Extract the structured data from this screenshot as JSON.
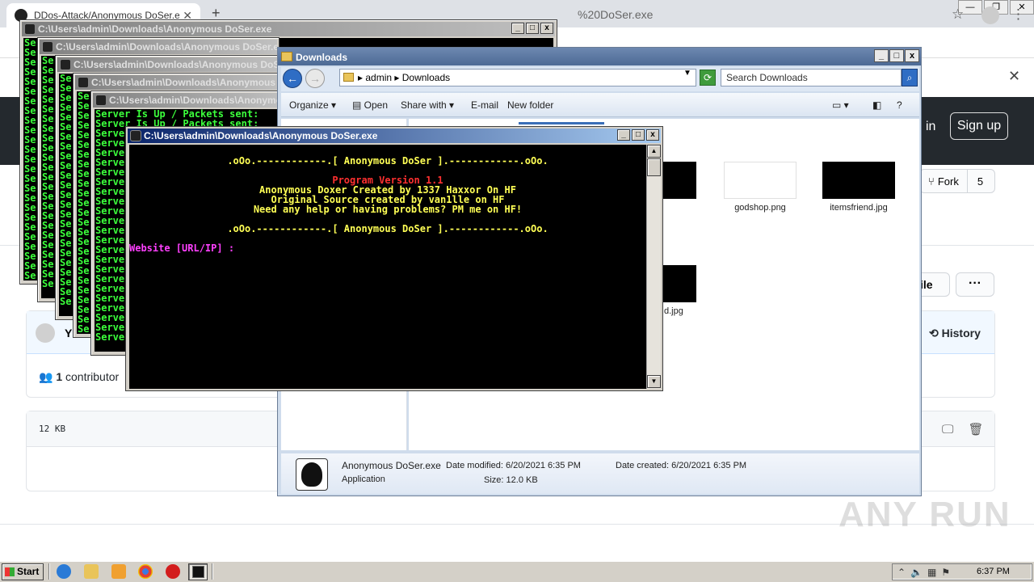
{
  "browser": {
    "tab_title": "DDos-Attack/Anonymous DoSer.exe",
    "tab_close": "✕",
    "new_tab": "+",
    "url_fragment": "%20DoSer.exe",
    "window_buttons": [
      "—",
      "❐",
      "✕"
    ]
  },
  "github": {
    "sign_in": "in",
    "sign_up": "Sign up",
    "fork_label": "Fork",
    "fork_count": "5",
    "file_button": "ile",
    "more_button": "···",
    "author_initial": "Y",
    "history": "History",
    "contributors_count": "1",
    "contributors_label": "contributor",
    "file_size": "12 KB"
  },
  "bg_consoles": [
    {
      "title": "C:\\Users\\admin\\Downloads\\Anonymous DoSer.exe",
      "lines": [
        "Se",
        "Se",
        "Se",
        "Se",
        "Se",
        "Se",
        "Se",
        "Se",
        "Se",
        "Se",
        "Se",
        "Se",
        "Se",
        "Se",
        "Se",
        "Se",
        "Se",
        "Se",
        "Se",
        "Se",
        "Se",
        "Se",
        "Se",
        "Se",
        "Se"
      ]
    },
    {
      "title": "C:\\Users\\admin\\Downloads\\Anonymous DoSer.exe",
      "lines": [
        "Se",
        "Se",
        "Se",
        "Se",
        "Se",
        "Se",
        "Se",
        "Se",
        "Se",
        "Se",
        "Se",
        "Se",
        "Se",
        "Se",
        "Se",
        "Se",
        "Se",
        "Se",
        "Se",
        "Se",
        "Se",
        "Se",
        "Se",
        "Se"
      ]
    },
    {
      "title": "C:\\Users\\admin\\Downloads\\Anonymous DoSer.exe",
      "lines": [
        "Se",
        "Se",
        "Se",
        "Se",
        "Se",
        "Se",
        "Se",
        "Se",
        "Se",
        "Se",
        "Se",
        "Se",
        "Se",
        "Se",
        "Se",
        "Se",
        "Se",
        "Se",
        "Se",
        "Se",
        "Se",
        "Se",
        "Se",
        "Se"
      ]
    },
    {
      "title": "C:\\Users\\admin\\Downloads\\Anonymous DoSer.exe",
      "lines": [
        "Se",
        "Se",
        "Se",
        "Se",
        "Se",
        "Se",
        "Se",
        "Se",
        "Se",
        "Se",
        "Se",
        "Se",
        "Se",
        "Se",
        "Se",
        "Se",
        "Se",
        "Se",
        "Se",
        "Se",
        "Se",
        "Se",
        "Se",
        "Se",
        "Se"
      ]
    },
    {
      "title": "C:\\Users\\admin\\Downloads\\Anonymous DoSer.exe",
      "lines": [
        "Server Is Up / Packets sent:",
        "Server Is Up / Packets sent:",
        "Serve",
        "Serve",
        "Serve",
        "Serve",
        "Serve",
        "Serve",
        "Serve",
        "Serve",
        "Serve",
        "Serve",
        "Serve",
        "Serve",
        "Serve",
        "Serve",
        "Serve",
        "Serve",
        "Serve",
        "Serve",
        "Serve",
        "Serve",
        "Serve",
        "Serve"
      ]
    }
  ],
  "explorer": {
    "title": "Downloads",
    "path": [
      "admin",
      "Downloads"
    ],
    "search_placeholder": "Search Downloads",
    "toolbar": {
      "organize": "Organize",
      "open": "Open",
      "share_with": "Share with",
      "email": "E-mail",
      "new_folder": "New folder"
    },
    "files": [
      {
        "name": "d.jpg"
      },
      {
        "name": "godshop.png"
      },
      {
        "name": "itemsfriend.jpg"
      },
      {
        "name": "d.jpg"
      }
    ],
    "details": {
      "file_name": "Anonymous DoSer.exe",
      "type": "Application",
      "date_modified_label": "Date modified:",
      "date_modified": "6/20/2021 6:35 PM",
      "date_created_label": "Date created:",
      "date_created": "6/20/2021 6:35 PM",
      "size_label": "Size:",
      "size": "12.0 KB"
    }
  },
  "main_console": {
    "title": "C:\\Users\\admin\\Downloads\\Anonymous DoSer.exe",
    "banner_top": ".oOo.------------.[ Anonymous DoSer ].------------.oOo.",
    "version": "Program Version 1.1",
    "credit1": "Anonymous Doxer Created by 1337 Haxxor On HF",
    "credit2": "Original Source created by van1lle on HF",
    "help": "Need any help or having problems? PM me on HF!",
    "banner_bottom": ".oOo.------------.[ Anonymous DoSer ].------------.oOo.",
    "prompt": "Website [URL/IP] :",
    "colors": {
      "banner": "#ffff55",
      "version": "#ff3030",
      "credits": "#ffff55",
      "prompt": "#ff40ff"
    }
  },
  "taskbar": {
    "start": "Start",
    "clock": "6:37 PM"
  },
  "watermark": "ANY RUN"
}
